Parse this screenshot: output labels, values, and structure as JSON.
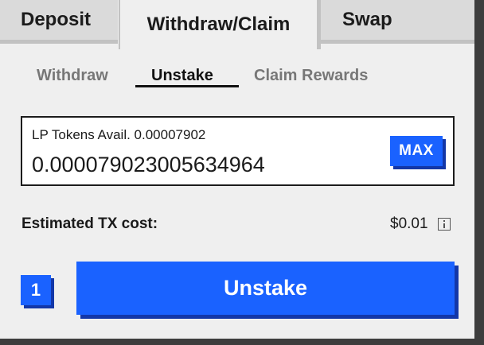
{
  "tabs": {
    "deposit": "Deposit",
    "withdraw_claim": "Withdraw/Claim",
    "swap": "Swap"
  },
  "subtabs": {
    "withdraw": "Withdraw",
    "unstake": "Unstake",
    "claim_rewards": "Claim Rewards"
  },
  "input": {
    "available_label": "LP Tokens Avail. 0.00007902",
    "value": "0.000079023005634964",
    "max_label": "MAX"
  },
  "tx": {
    "label": "Estimated TX cost:",
    "value": "$0.01"
  },
  "action": {
    "step": "1",
    "button_label": "Unstake"
  },
  "colors": {
    "accent": "#1a62ff",
    "accent_shadow": "#1337a8",
    "panel_bg": "#efefef",
    "tab_bg": "#dadada"
  }
}
